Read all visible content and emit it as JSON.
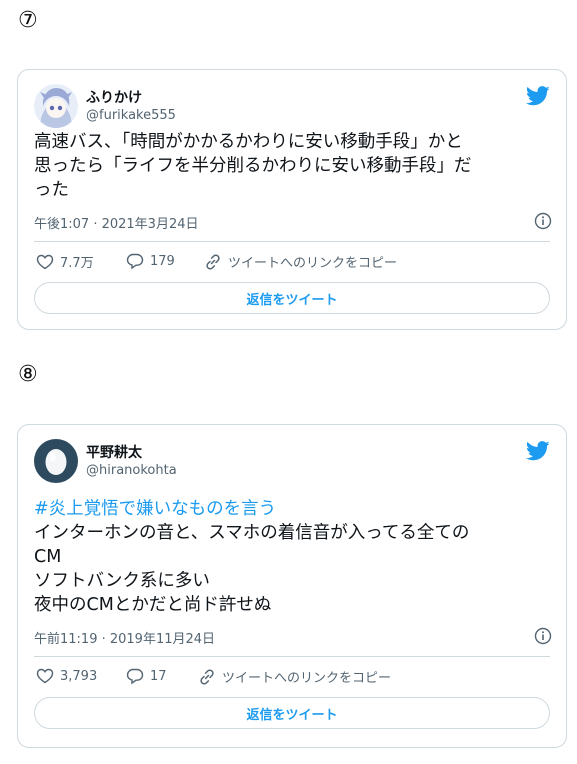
{
  "tweets": [
    {
      "marker": "⑦",
      "name": "ふりかけ",
      "handle": "@furikake555",
      "text_lines": [
        "高速バス、「時間がかかるかわりに安い移動手段」かと",
        "思ったら「ライフを半分削るかわりに安い移動手段」だ",
        "った"
      ],
      "timestamp": "午後1:07 · 2021年3月24日",
      "likes": "7.7万",
      "replies": "179",
      "share_label": "ツイートへのリンクをコピー",
      "reply_button": "返信をツイート"
    },
    {
      "marker": "⑧",
      "name": "平野耕太",
      "handle": "@hiranokohta",
      "hashtag": "#炎上覚悟で嫌いなものを言う",
      "text_lines": [
        "インターホンの音と、スマホの着信音が入ってる全ての",
        "CM",
        "ソフトバンク系に多い",
        "夜中のCMとかだと尚ド許せぬ"
      ],
      "timestamp": "午前11:19 · 2019年11月24日",
      "likes": "3,793",
      "replies": "17",
      "share_label": "ツイートへのリンクをコピー",
      "reply_button": "返信をツイート"
    }
  ],
  "colors": {
    "accent": "#1d9bf0",
    "muted": "#536471",
    "border": "#cfd9de"
  },
  "icons": [
    "twitter-bird-icon",
    "info-icon",
    "heart-icon",
    "reply-bubble-icon",
    "link-icon"
  ]
}
